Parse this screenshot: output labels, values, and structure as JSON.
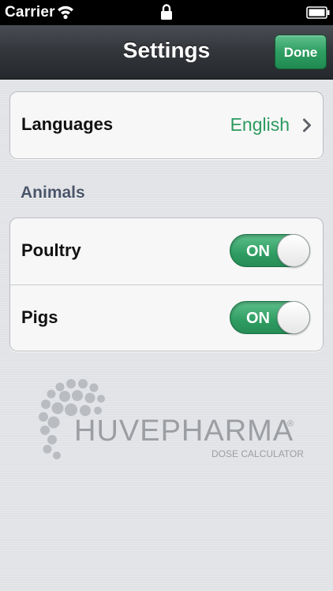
{
  "status_bar": {
    "carrier": "Carrier",
    "wifi_icon": "wifi-icon",
    "lock_icon": "lock-icon",
    "battery_icon": "battery-icon"
  },
  "nav": {
    "title": "Settings",
    "done_label": "Done"
  },
  "settings": {
    "languages": {
      "label": "Languages",
      "value": "English",
      "icon": "chevron-right-icon"
    }
  },
  "animals": {
    "header": "Animals",
    "items": [
      {
        "label": "Poultry",
        "toggle_text": "ON",
        "on": true
      },
      {
        "label": "Pigs",
        "toggle_text": "ON",
        "on": true
      }
    ]
  },
  "brand": {
    "name": "HUVEPHARMA",
    "registered": "®",
    "subtitle": "DOSE CALCULATOR"
  },
  "colors": {
    "accent_green": "#2c9a5f",
    "nav_bg": "#34373c",
    "section_header": "#4a556b",
    "logo_gray": "#9b9ea2"
  }
}
